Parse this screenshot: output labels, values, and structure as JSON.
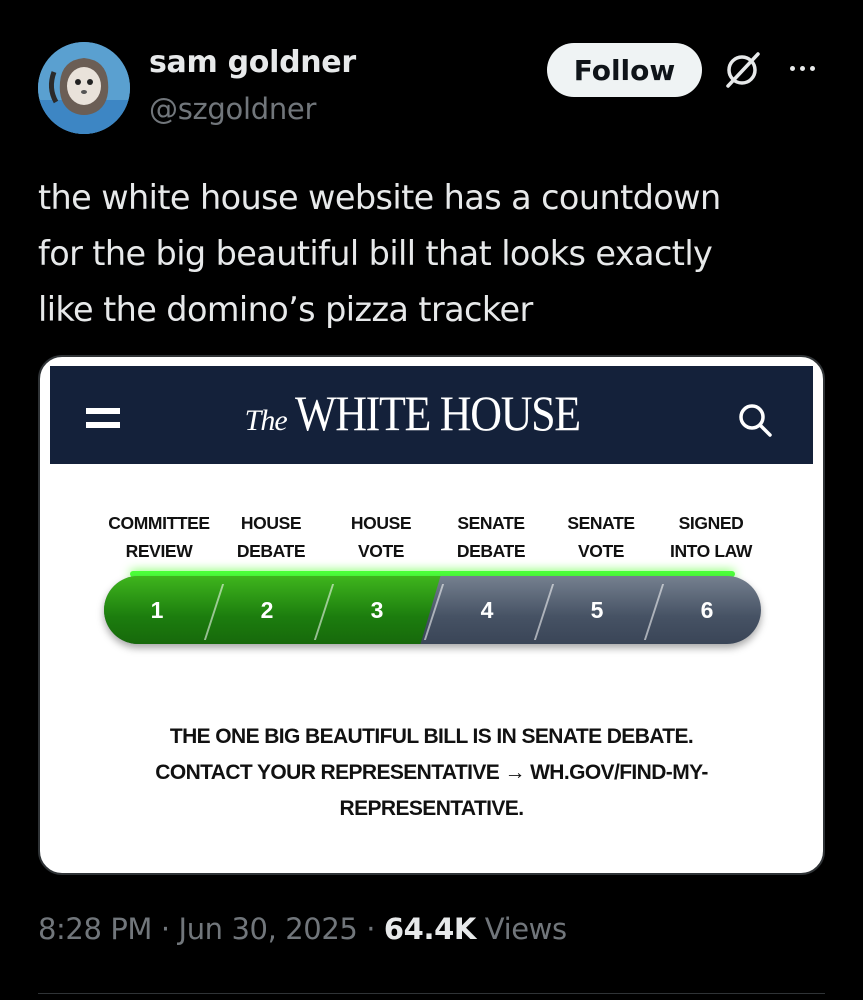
{
  "tweet": {
    "author_name": "sam goldner",
    "author_handle": "@szgoldner",
    "follow_label": "Follow",
    "text_lines": [
      "the white house website has a countdown",
      "for the big beautiful bill that looks exactly",
      "like the domino’s pizza tracker"
    ],
    "time": "8:28 PM",
    "date": "Jun 30, 2025",
    "separator": "·",
    "views_count": "64.4K",
    "views_label": "Views"
  },
  "screenshot": {
    "logo_the": "The",
    "logo_main": "WHITE HOUSE",
    "steps": [
      {
        "line1": "COMMITTEE",
        "line2": "REVIEW",
        "number": "1"
      },
      {
        "line1": "HOUSE",
        "line2": "DEBATE",
        "number": "2"
      },
      {
        "line1": "HOUSE",
        "line2": "VOTE",
        "number": "3"
      },
      {
        "line1": "SENATE",
        "line2": "DEBATE",
        "number": "4"
      },
      {
        "line1": "SENATE",
        "line2": "VOTE",
        "number": "5"
      },
      {
        "line1": "SIGNED",
        "line2": "INTO LAW",
        "number": "6"
      }
    ],
    "completed_steps": 3,
    "total_steps": 6,
    "message_lines": [
      "THE ONE BIG BEAUTIFUL BILL IS IN SENATE DEBATE.",
      "CONTACT YOUR REPRESENTATIVE → WH.GOV/FIND-MY-",
      "REPRESENTATIVE."
    ]
  },
  "colors": {
    "follow_bg": "#eff3f4",
    "header_navy": "#14213a",
    "progress_green": "#1c7d0e",
    "progress_gray": "#465264",
    "glow_green": "#4cff3a",
    "muted_text": "#71767b"
  },
  "icons": {
    "avatar": "avatar-image",
    "grok": "grok-icon",
    "more": "more-options-icon",
    "menu": "hamburger-menu-icon",
    "search": "search-icon"
  }
}
